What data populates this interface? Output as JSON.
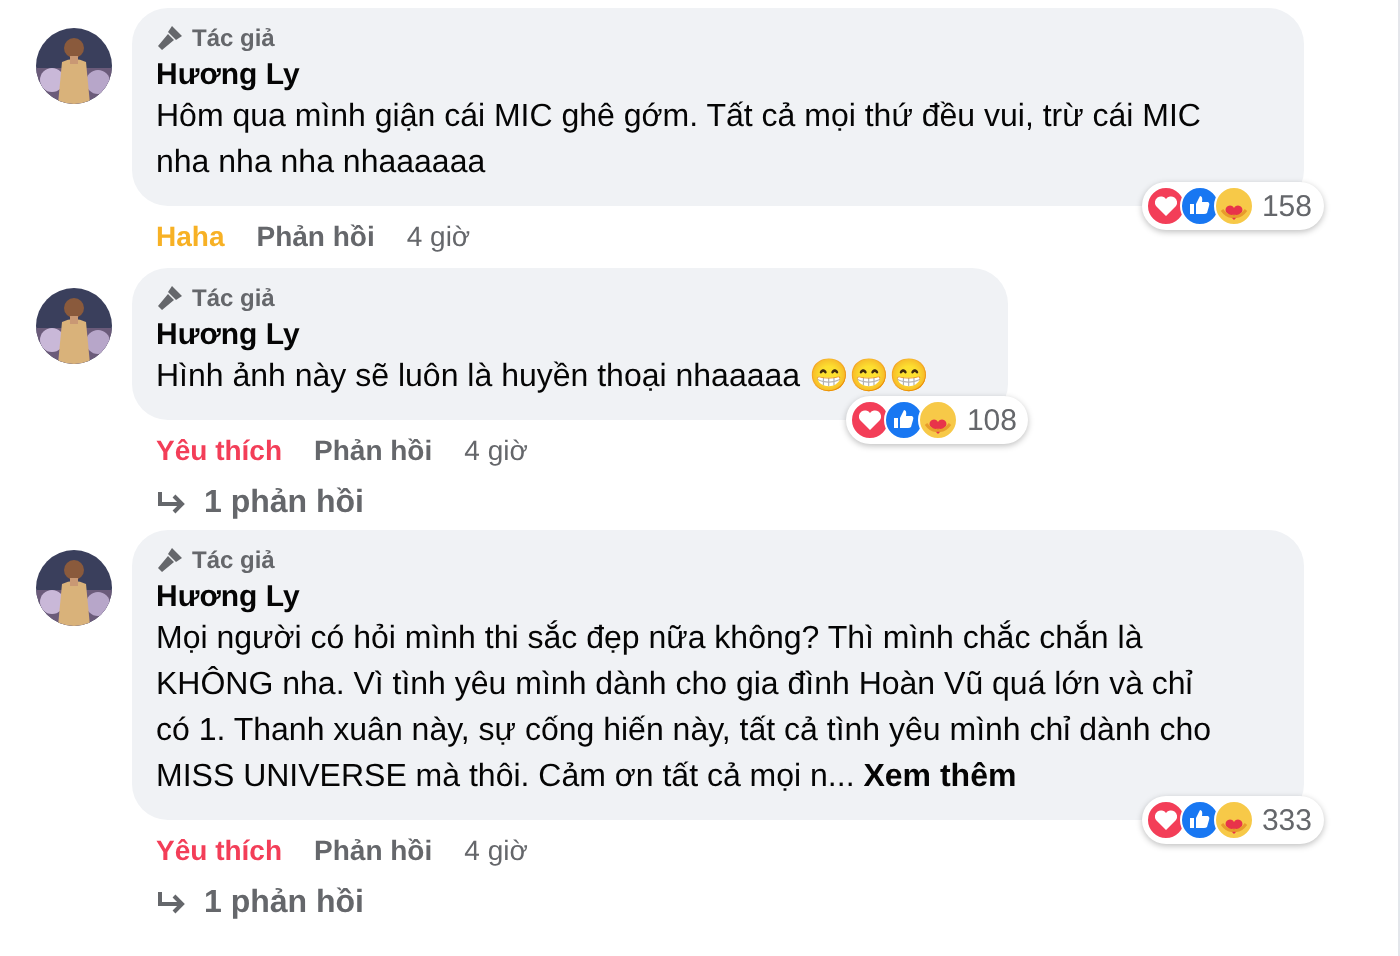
{
  "comments": [
    {
      "badge": "Tác giả",
      "author": "Hương Ly",
      "text": "Hôm qua mình giận cái MIC ghê gớm. Tất cả mọi thứ đều vui, trừ cái MIC nha nha nha nhaaaaaa",
      "reaction": {
        "label": "Haha",
        "kind": "haha"
      },
      "reply_label": "Phản hồi",
      "time": "4 giờ",
      "reaction_count": "158"
    },
    {
      "badge": "Tác giả",
      "author": "Hương Ly",
      "text": "Hình ảnh này sẽ luôn là huyền thoại nhaaaaa 😁😁😁",
      "reaction": {
        "label": "Yêu thích",
        "kind": "love"
      },
      "reply_label": "Phản hồi",
      "time": "4 giờ",
      "reaction_count": "108",
      "replies_link": "1 phản hồi"
    },
    {
      "badge": "Tác giả",
      "author": "Hương Ly",
      "text": "Mọi người có hỏi mình thi sắc đẹp nữa không? Thì mình chắc chắn là KHÔNG nha. Vì tình yêu mình dành cho gia đình Hoàn Vũ quá lớn và chỉ có 1. Thanh xuân này, sự cống hiến này, tất cả tình yêu mình chỉ dành cho MISS UNIVERSE mà thôi. Cảm ơn tất cả mọi n...",
      "see_more": "Xem thêm",
      "reaction": {
        "label": "Yêu thích",
        "kind": "love"
      },
      "reply_label": "Phản hồi",
      "time": "4 giờ",
      "reaction_count": "333",
      "replies_link": "1 phản hồi"
    }
  ]
}
